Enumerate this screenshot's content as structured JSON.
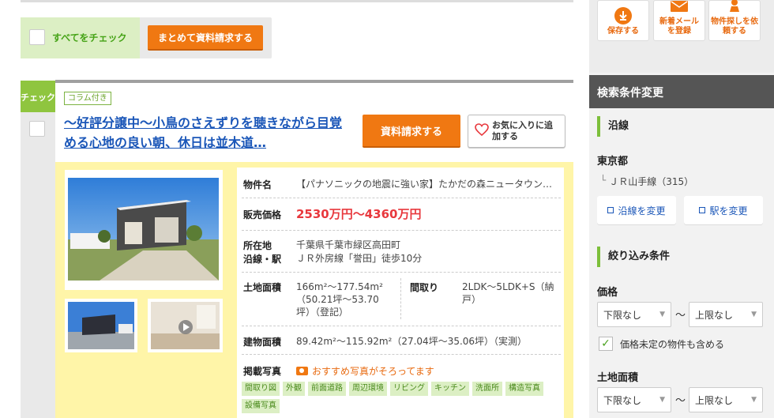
{
  "toolbar": {
    "check_all_label": "すべてをチェック",
    "bulk_request_label": "まとめて資料請求する"
  },
  "card": {
    "check_badge": "チェック",
    "column_badge": "コラム付き",
    "title": "～好評分譲中～小鳥のさえずりを聴きながら目覚める心地の良い朝、休日は並木道…",
    "request_label": "資料請求する",
    "favorite_label": "お気に入りに追加する",
    "rows": {
      "name_label": "物件名",
      "name_value": "【パナソニックの地震に強い家】たかだの森ニュータウン…",
      "price_label": "販売価格",
      "price_value": "2530万円～4360万円",
      "address_label": "所在地",
      "line_label": "沿線・駅",
      "address_value": "千葉県千葉市緑区高田町",
      "line_value": "ＪＲ外房線「誉田」徒歩10分",
      "land_label": "土地面積",
      "land_value": "166m²～177.54m²（50.21坪～53.70坪）（登記）",
      "layout_label": "間取り",
      "layout_value": "2LDK～5LDK+S（納戸）",
      "building_label": "建物面積",
      "building_value": "89.42m²～115.92m²（27.04坪～35.06坪）（実測）",
      "photos_label": "掲載写真",
      "photos_note": "おすすめ写真がそろってます",
      "photo_tags": [
        "間取り図",
        "外観",
        "前面道路",
        "周辺環境",
        "リビング",
        "キッチン",
        "洗面所",
        "構造写真",
        "設備写真"
      ]
    }
  },
  "side": {
    "save_label": "保存する",
    "newmail_label": "新着メールを登録",
    "agent_label": "物件探しを依頼する",
    "search_change_title": "検索条件変更",
    "line_section": "沿線",
    "prefecture": "東京都",
    "line_item": "ＪＲ山手線（315）",
    "change_line": "沿線を変更",
    "change_station": "駅を変更",
    "filter_section": "絞り込み条件",
    "price_title": "価格",
    "price_min": "下限なし",
    "price_max": "上限なし",
    "price_sep": "～",
    "include_undecided": "価格未定の物件も含める",
    "land_title": "土地面積",
    "land_min": "下限なし",
    "land_max": "上限なし",
    "land_sep": "～"
  },
  "colors": {
    "accent_orange": "#f07812",
    "accent_green": "#8fc53f",
    "price_red": "#e8383d",
    "link_blue": "#1a56b8"
  }
}
